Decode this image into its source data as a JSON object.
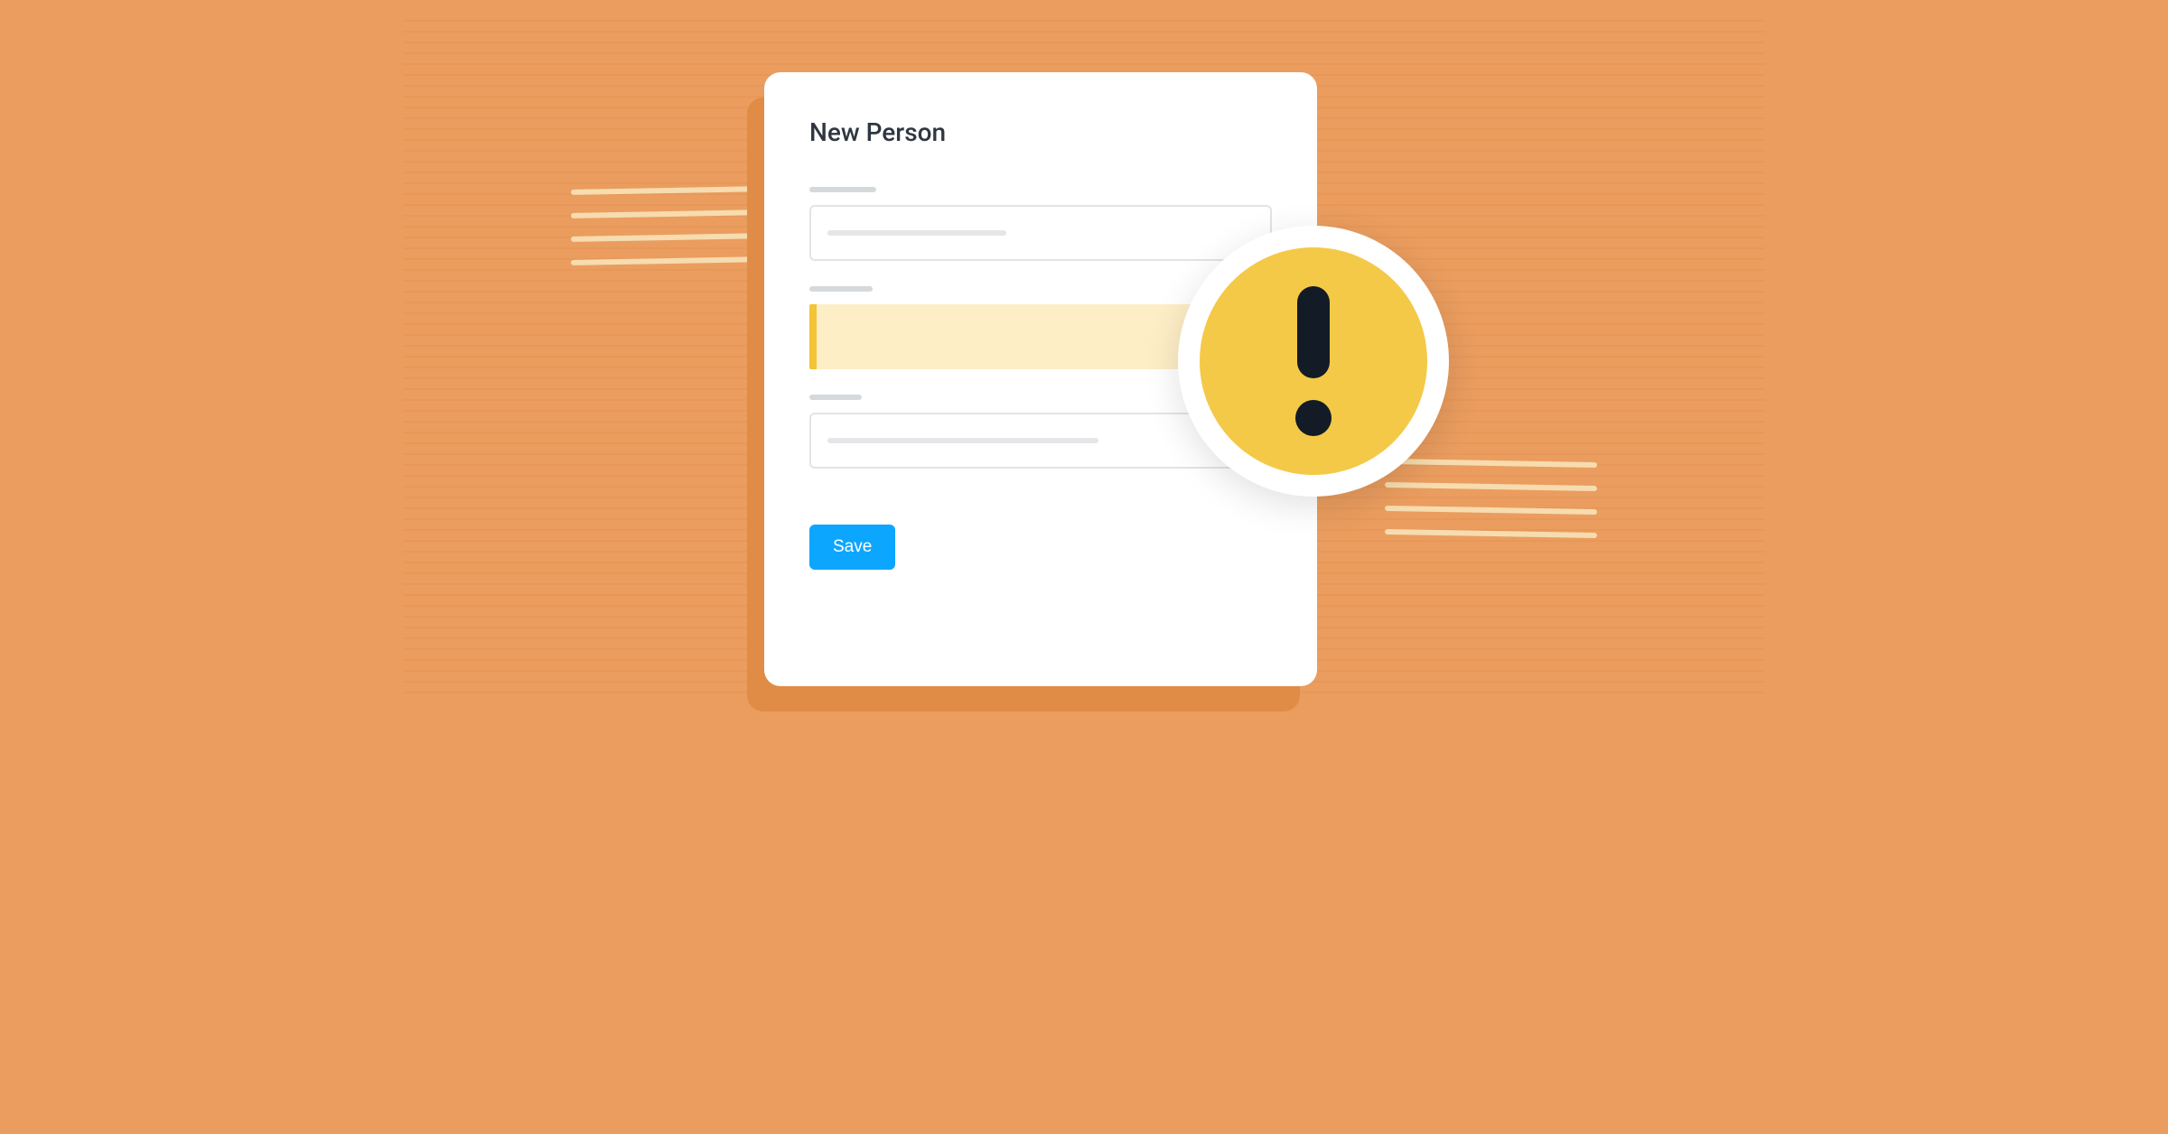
{
  "card": {
    "title": "New Person"
  },
  "fields": {
    "field1": {
      "label_width": 74,
      "placeholder_width": 198
    },
    "field2": {
      "label_width": 70
    },
    "field3": {
      "label_width": 58,
      "placeholder_width": 300
    }
  },
  "buttons": {
    "save_label": "Save"
  },
  "icons": {
    "alert": "exclamation-icon"
  },
  "colors": {
    "background": "#ea9d5f",
    "card": "#ffffff",
    "card_shadow": "#e08c46",
    "save_button": "#0da6ff",
    "warn_fill": "#fdeec6",
    "warn_accent": "#f3c338",
    "alert_circle": "#f4c947",
    "alert_glyph": "#121b26"
  }
}
